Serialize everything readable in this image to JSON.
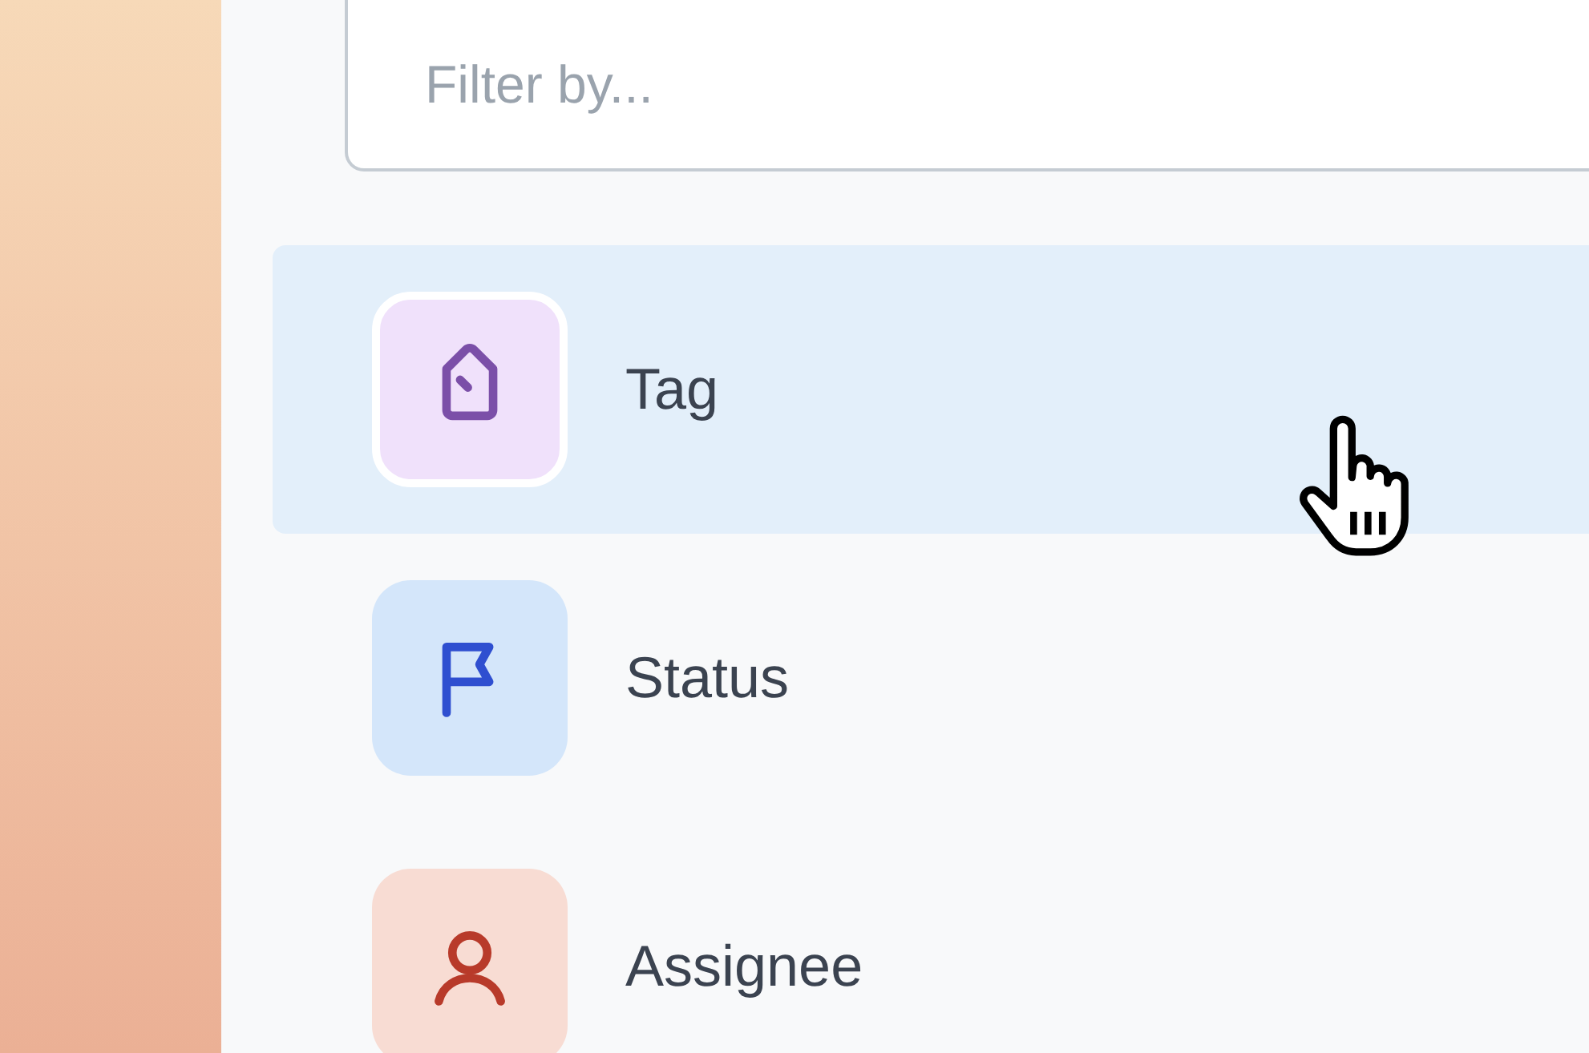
{
  "filter": {
    "placeholder": "Filter by..."
  },
  "items": [
    {
      "label": "Tag",
      "kind": "tag",
      "color": "#7b4fa8",
      "selected": true
    },
    {
      "label": "Status",
      "kind": "flag",
      "color": "#2f4fd0",
      "selected": false
    },
    {
      "label": "Assignee",
      "kind": "person",
      "color": "#b83a2a",
      "selected": false
    }
  ]
}
